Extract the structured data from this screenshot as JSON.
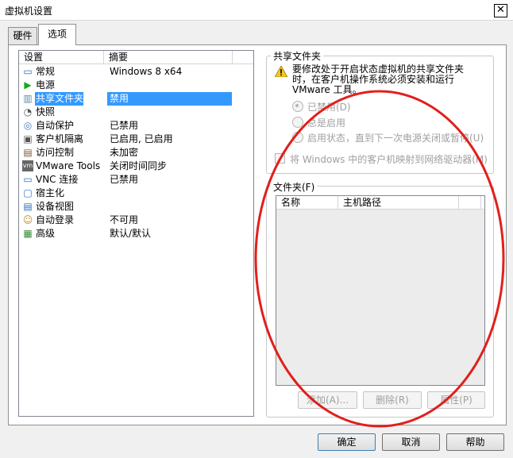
{
  "window": {
    "title": "虚拟机设置",
    "close_label": "✕"
  },
  "tabs": [
    {
      "label": "硬件",
      "active": false
    },
    {
      "label": "选项",
      "active": true
    }
  ],
  "settings": {
    "columns": [
      "设置",
      "摘要"
    ],
    "rows": [
      {
        "icon": "monitor-icon",
        "glyph": "▭",
        "color": "#2a6fbf",
        "name": "常规",
        "value": "Windows 8 x64"
      },
      {
        "icon": "power-play-icon",
        "glyph": "▶",
        "color": "#1da51d",
        "name": "电源",
        "value": ""
      },
      {
        "icon": "shared-folder-icon",
        "glyph": "▥",
        "color": "#5d8aa8",
        "name": "共享文件夹",
        "value": "禁用",
        "selected": true
      },
      {
        "icon": "snapshot-icon",
        "glyph": "◔",
        "color": "#555555",
        "name": "快照",
        "value": ""
      },
      {
        "icon": "autoprotect-icon",
        "glyph": "◎",
        "color": "#4a78b5",
        "name": "自动保护",
        "value": "已禁用"
      },
      {
        "icon": "lock-icon",
        "glyph": "▣",
        "color": "#555555",
        "name": "客户机隔离",
        "value": "已启用, 已启用"
      },
      {
        "icon": "access-key-icon",
        "glyph": "▤",
        "color": "#7a5a3a",
        "name": "访问控制",
        "value": "未加密"
      },
      {
        "icon": "vm-tools-icon",
        "glyph": "vm",
        "color": "#666666",
        "name": "VMware Tools",
        "value": "关闭时间同步"
      },
      {
        "icon": "vnc-icon",
        "glyph": "▭",
        "color": "#2a6fbf",
        "name": "VNC 连接",
        "value": "已禁用"
      },
      {
        "icon": "unity-icon",
        "glyph": "▢",
        "color": "#2a6fbf",
        "name": "宿主化",
        "value": ""
      },
      {
        "icon": "device-view-icon",
        "glyph": "▤",
        "color": "#2a6fbf",
        "name": "设备视图",
        "value": ""
      },
      {
        "icon": "autologin-user-icon",
        "glyph": "☺",
        "color": "#c08a2a",
        "name": "自动登录",
        "value": "不可用"
      },
      {
        "icon": "advanced-icon",
        "glyph": "▦",
        "color": "#3a8a3a",
        "name": "高级",
        "value": "默认/默认"
      }
    ]
  },
  "shared_folders": {
    "group_label": "共享文件夹",
    "warning": "要修改处于开启状态虚拟机的共享文件夹时，在客户机操作系统必须安装和运行VMware 工具。",
    "radio_disabled": "已禁用(D)",
    "radio_always": "总是启用",
    "radio_until": "启用状态，直到下一次电源关闭或暂停(U)",
    "selected_radio": "disabled",
    "map_drive_label": "将 Windows 中的客户机映射到网络驱动器(M)",
    "map_drive_checked": false
  },
  "folders": {
    "group_label": "文件夹(F)",
    "columns": [
      "名称",
      "主机路径"
    ],
    "add_label": "添加(A)...",
    "remove_label": "删除(R)",
    "properties_label": "属性(P)"
  },
  "footer": {
    "ok_label": "确定",
    "cancel_label": "取消",
    "help_label": "帮助"
  },
  "colors": {
    "selection": "#3399ff",
    "annotation": "#e0201c"
  }
}
